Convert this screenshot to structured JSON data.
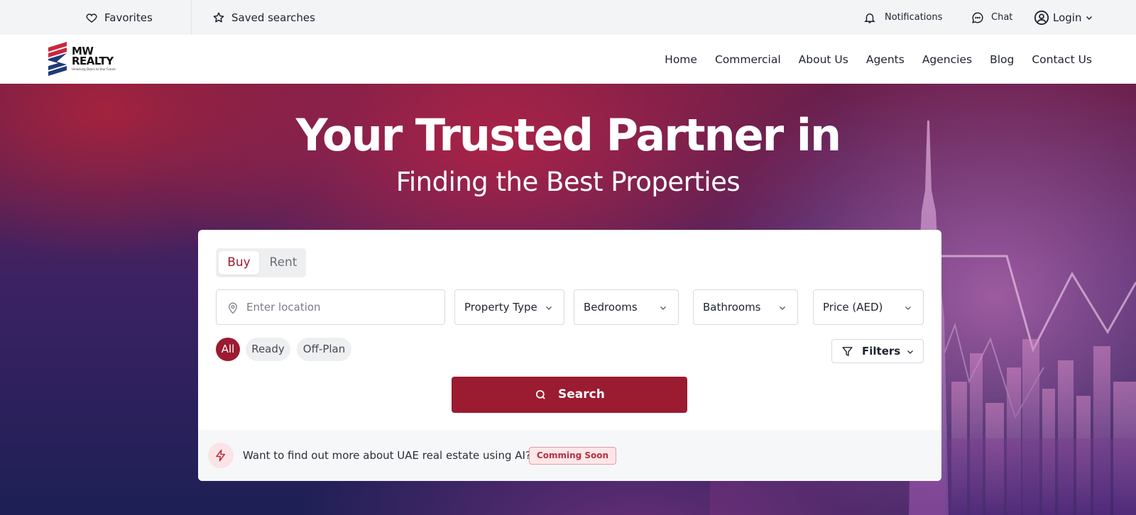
{
  "topbar": {
    "favorites": "Favorites",
    "saved_searches": "Saved searches",
    "notifications": "Notifications",
    "chat": "Chat",
    "login": "Login"
  },
  "brand": {
    "line1": "MW",
    "line2": "REALTY",
    "tagline": "Unlocking Doors to Your Future"
  },
  "nav": {
    "items": [
      "Home",
      "Commercial",
      "About Us",
      "Agents",
      "Agencies",
      "Blog",
      "Contact Us"
    ]
  },
  "hero": {
    "title": "Your Trusted Partner in",
    "subtitle": "Finding the Best Properties"
  },
  "search": {
    "tabs": [
      "Buy",
      "Rent"
    ],
    "active_tab": "Buy",
    "location_placeholder": "Enter location",
    "property_type": "Property Type",
    "bedrooms": "Bedrooms",
    "bathrooms": "Bathrooms",
    "price": "Price (AED)",
    "chips": [
      "All",
      "Ready",
      "Off-Plan"
    ],
    "active_chip": "All",
    "filters": "Filters",
    "search_button": "Search"
  },
  "ai": {
    "text": "Want to find out more about UAE real estate using AI?",
    "badge": "Comming Soon"
  },
  "colors": {
    "brand": "#9b1b30",
    "topbar_bg": "#f3f4f6",
    "badge_bg": "#fde6e8"
  },
  "icons": {
    "favorites": "heart-icon",
    "saved": "star-icon",
    "notifications": "bell-icon",
    "chat": "chat-bubble-icon",
    "login": "user-circle-icon",
    "location": "map-pin-icon",
    "filters": "funnel-icon",
    "search": "search-icon",
    "ai": "lightning-icon"
  }
}
